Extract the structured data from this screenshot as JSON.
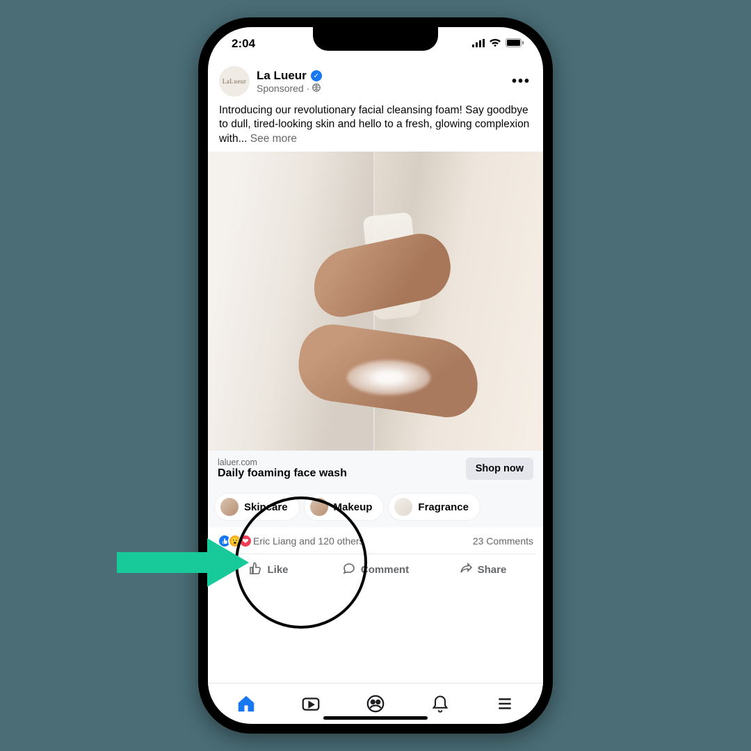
{
  "status": {
    "time": "2:04"
  },
  "post": {
    "page_name": "La Lueur",
    "sponsored_label": "Sponsored",
    "body_text": "Introducing our revolutionary facial cleansing foam! Say goodbye to dull, tired-looking skin and hello to a fresh, glowing complexion with... ",
    "see_more": "See more"
  },
  "cta": {
    "domain": "laluer.com",
    "title": "Daily foaming face wash",
    "button": "Shop now"
  },
  "pills": {
    "0": {
      "label": "Skincare"
    },
    "1": {
      "label": "Makeup"
    },
    "2": {
      "label": "Fragrance"
    }
  },
  "reactions": {
    "names": "Eric Liang and 120 others",
    "comments": "23 Comments"
  },
  "actions": {
    "like": "Like",
    "comment": "Comment",
    "share": "Share"
  }
}
